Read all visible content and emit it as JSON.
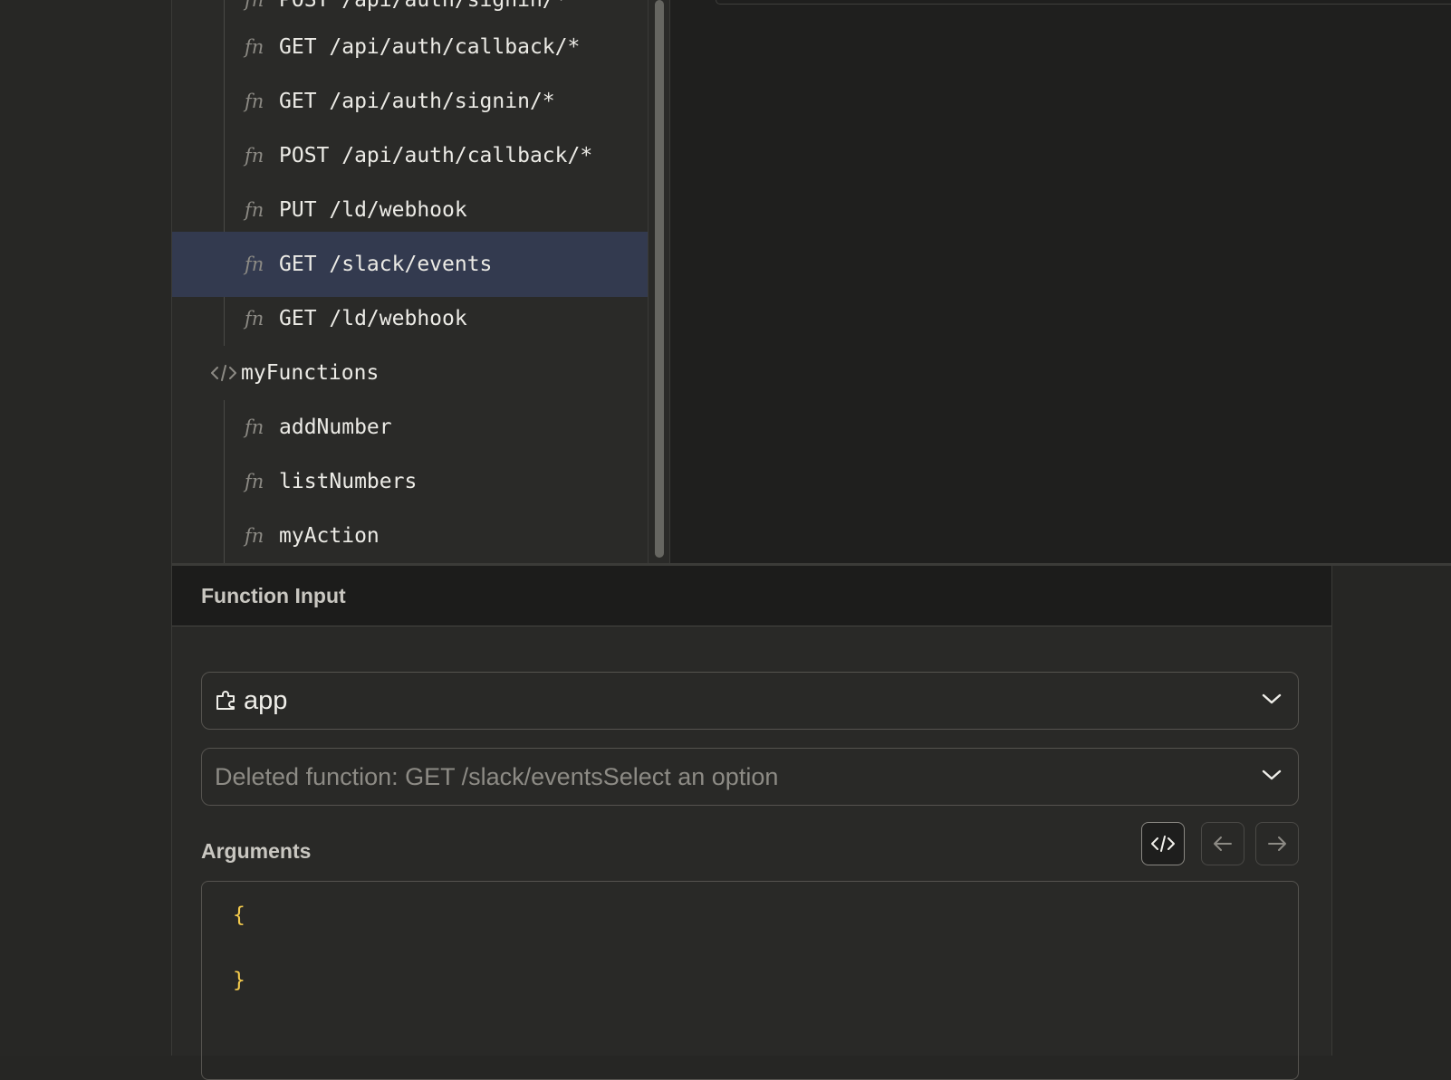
{
  "tree": {
    "partial_top_label": "POST /api/auth/signin/*",
    "items": [
      {
        "kind": "fn",
        "icon": "fn-icon",
        "label": "GET /api/auth/callback/*"
      },
      {
        "kind": "fn",
        "icon": "fn-icon",
        "label": "GET /api/auth/signin/*"
      },
      {
        "kind": "fn",
        "icon": "fn-icon",
        "label": "POST /api/auth/callback/*"
      },
      {
        "kind": "fn",
        "icon": "fn-icon",
        "label": "PUT /ld/webhook"
      },
      {
        "kind": "fn",
        "icon": "fn-icon",
        "label": "GET /slack/events",
        "selected": true
      },
      {
        "kind": "fn",
        "icon": "fn-icon",
        "label": "GET /ld/webhook"
      }
    ],
    "folder": {
      "icon": "code-icon",
      "label": "myFunctions"
    },
    "folder_items": [
      {
        "kind": "fn",
        "icon": "fn-icon",
        "label": "addNumber"
      },
      {
        "kind": "fn",
        "icon": "fn-icon",
        "label": "listNumbers"
      },
      {
        "kind": "fn",
        "icon": "fn-icon",
        "label": "myAction"
      }
    ],
    "fn_glyph": "fn"
  },
  "function_input": {
    "title": "Function Input",
    "component_select": {
      "icon": "puzzle-icon",
      "value": "app"
    },
    "function_select": {
      "placeholder": "Deleted function: GET /slack/eventsSelect an option"
    },
    "arguments_label": "Arguments",
    "toolbar": {
      "code_icon": "code-icon",
      "back_icon": "arrow-left-icon",
      "forward_icon": "arrow-right-icon"
    },
    "editor": {
      "open_brace": "{",
      "close_brace": "}"
    }
  },
  "colors": {
    "selected_row": "#333a4f",
    "brace": "#f2c94c",
    "background": "#262624"
  }
}
